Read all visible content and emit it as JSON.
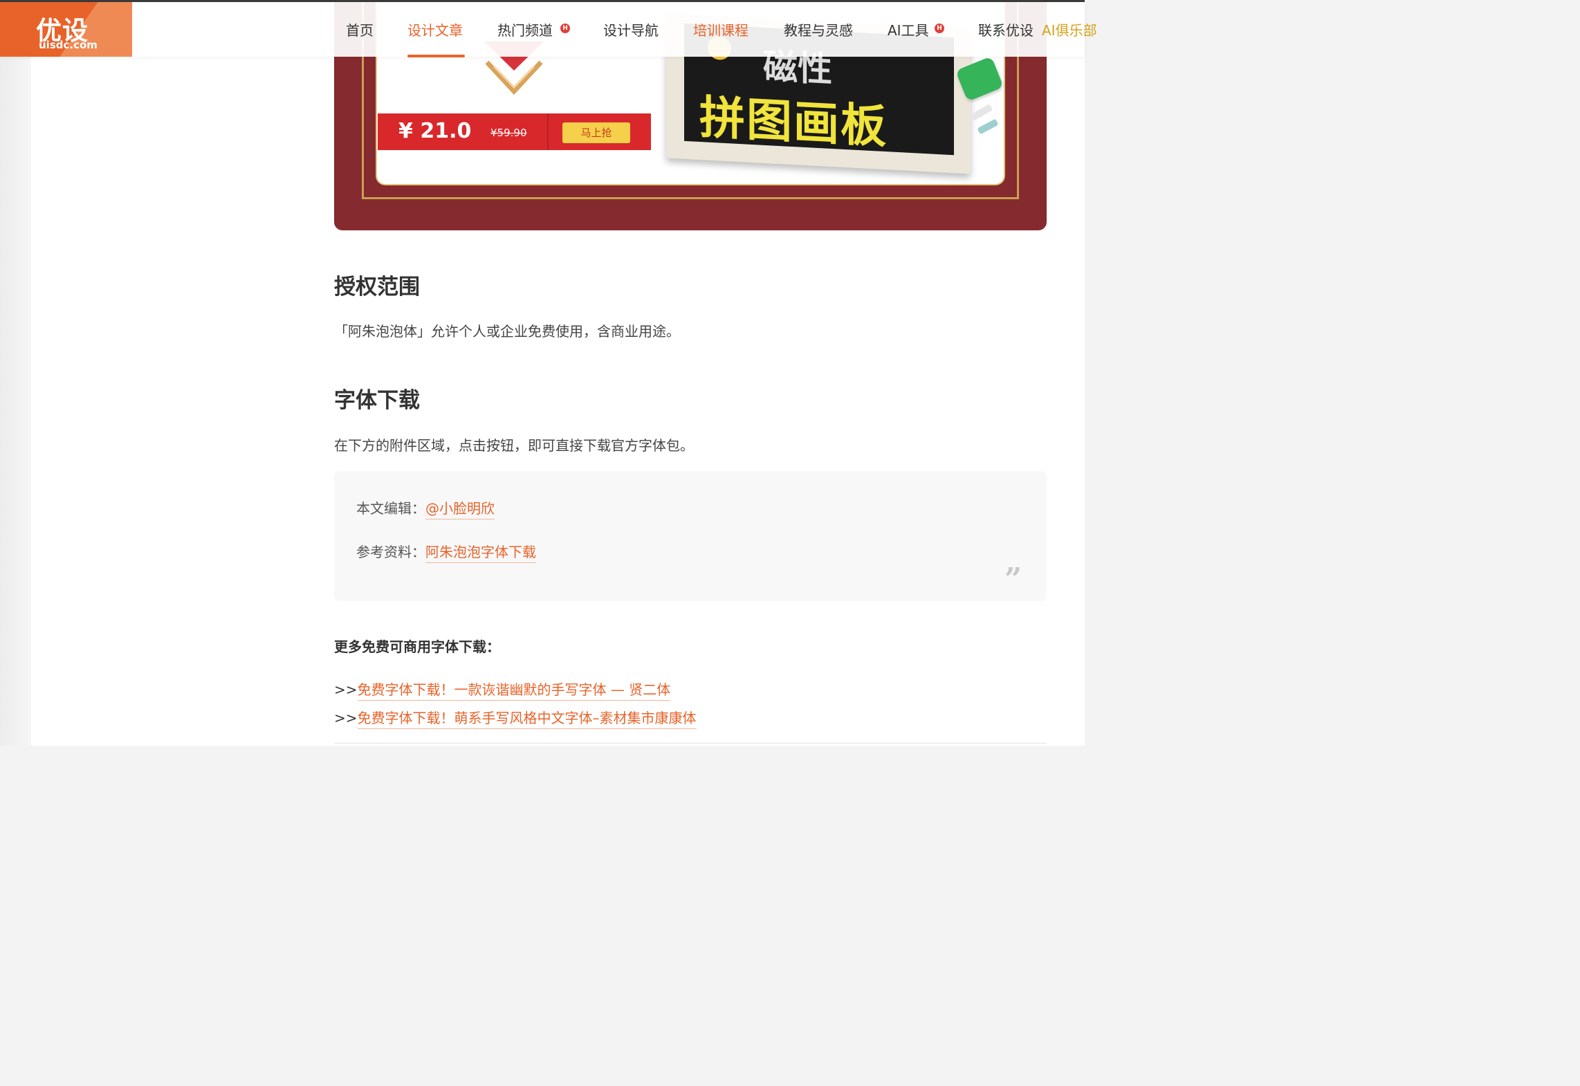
{
  "brand": {
    "logo_text": "优设",
    "logo_sub": "uisdc.com",
    "accent": "#e8632a"
  },
  "nav": {
    "items": [
      {
        "label": "首页",
        "state": "normal"
      },
      {
        "label": "设计文章",
        "state": "active"
      },
      {
        "label": "热门频道",
        "state": "normal",
        "badge": "H"
      },
      {
        "label": "设计导航",
        "state": "normal"
      },
      {
        "label": "培训课程",
        "state": "highlight"
      },
      {
        "label": "教程与灵感",
        "state": "normal"
      },
      {
        "label": "AI工具",
        "state": "normal",
        "badge": "H"
      },
      {
        "label": "联系优设",
        "state": "normal"
      },
      {
        "label": "AI俱乐部",
        "state": "gold"
      }
    ]
  },
  "banner": {
    "price": "¥ 21.0",
    "old_price": "¥59.90",
    "buy_label": "马上抢",
    "board_title": "拼图画板",
    "board_top": "磁性"
  },
  "article": {
    "section1_title": "授权范围",
    "section1_text": "「阿朱泡泡体」允许个人或企业免费使用，含商业用途。",
    "section2_title": "字体下载",
    "section2_text": "在下方的附件区域，点击按钮，即可直接下载官方字体包。"
  },
  "info_box": {
    "editor_label": "本文编辑：",
    "editor_name": "@小脸明欣",
    "ref_label": "参考资料：",
    "ref_link": "阿朱泡泡字体下载",
    "quote_glyph": "”"
  },
  "more": {
    "title": "更多免费可商用字体下载：",
    "prefix": ">>",
    "links": [
      "免费字体下载！一款诙谐幽默的手写字体 — 贤二体",
      "免费字体下载！萌系手写风格中文字体–素材集市康康体"
    ]
  }
}
